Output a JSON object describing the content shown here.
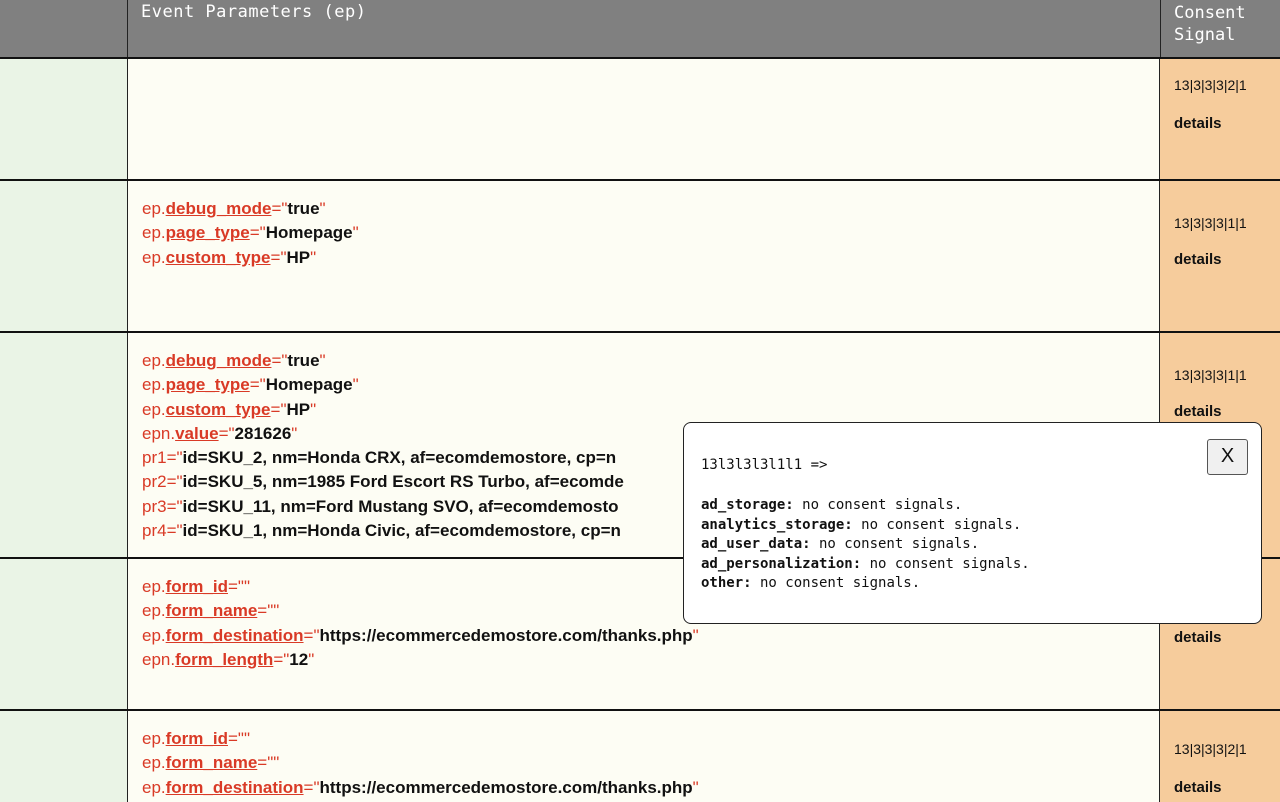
{
  "header": {
    "event_params": "Event Parameters (ep)",
    "consent_signal": "Consent Signal"
  },
  "rows": [
    {
      "params": [],
      "consent": "13|3|3|3|2|1",
      "details": "details"
    },
    {
      "params": [
        {
          "prefix": "ep.",
          "key": "debug_mode",
          "value": "true"
        },
        {
          "prefix": "ep.",
          "key": "page_type",
          "value": "Homepage"
        },
        {
          "prefix": "ep.",
          "key": "custom_type",
          "value": "HP"
        }
      ],
      "consent": "13|3|3|3|1|1",
      "details": "details"
    },
    {
      "params": [
        {
          "prefix": "ep.",
          "key": "debug_mode",
          "value": "true"
        },
        {
          "prefix": "ep.",
          "key": "page_type",
          "value": "Homepage"
        },
        {
          "prefix": "ep.",
          "key": "custom_type",
          "value": "HP"
        },
        {
          "prefix": "epn.",
          "key": "value",
          "value": "281626"
        },
        {
          "prefix": "",
          "key": "pr1",
          "value": "id=SKU_2, nm=Honda CRX, af=ecomdemostore, cp=n"
        },
        {
          "prefix": "",
          "key": "pr2",
          "value": "id=SKU_5, nm=1985 Ford Escort RS Turbo, af=ecomde"
        },
        {
          "prefix": "",
          "key": "pr3",
          "value": "id=SKU_11, nm=Ford Mustang SVO, af=ecomdemosto"
        },
        {
          "prefix": "",
          "key": "pr4",
          "value": "id=SKU_1, nm=Honda Civic, af=ecomdemostore, cp=n"
        }
      ],
      "consent": "13|3|3|3|1|1",
      "details": "details"
    },
    {
      "params": [
        {
          "prefix": "ep.",
          "key": "form_id",
          "value": ""
        },
        {
          "prefix": "ep.",
          "key": "form_name",
          "value": ""
        },
        {
          "prefix": "ep.",
          "key": "form_destination",
          "value": "https://ecommercedemostore.com/thanks.php"
        },
        {
          "prefix": "epn.",
          "key": "form_length",
          "value": "12"
        }
      ],
      "consent": "",
      "details": "details"
    },
    {
      "params": [
        {
          "prefix": "ep.",
          "key": "form_id",
          "value": ""
        },
        {
          "prefix": "ep.",
          "key": "form_name",
          "value": ""
        },
        {
          "prefix": "ep.",
          "key": "form_destination",
          "value": "https://ecommercedemostore.com/thanks.php"
        }
      ],
      "consent": "13|3|3|3|2|1",
      "details": "details"
    }
  ],
  "popup": {
    "code": "13l3l3l3l1l1 =>",
    "close_label": "X",
    "items": [
      {
        "key": "ad_storage:",
        "text": " no consent signals."
      },
      {
        "key": "analytics_storage:",
        "text": " no consent signals."
      },
      {
        "key": "ad_user_data:",
        "text": " no consent signals."
      },
      {
        "key": "ad_personalization:",
        "text": " no consent signals."
      },
      {
        "key": "other:",
        "text": " no consent signals."
      }
    ]
  }
}
